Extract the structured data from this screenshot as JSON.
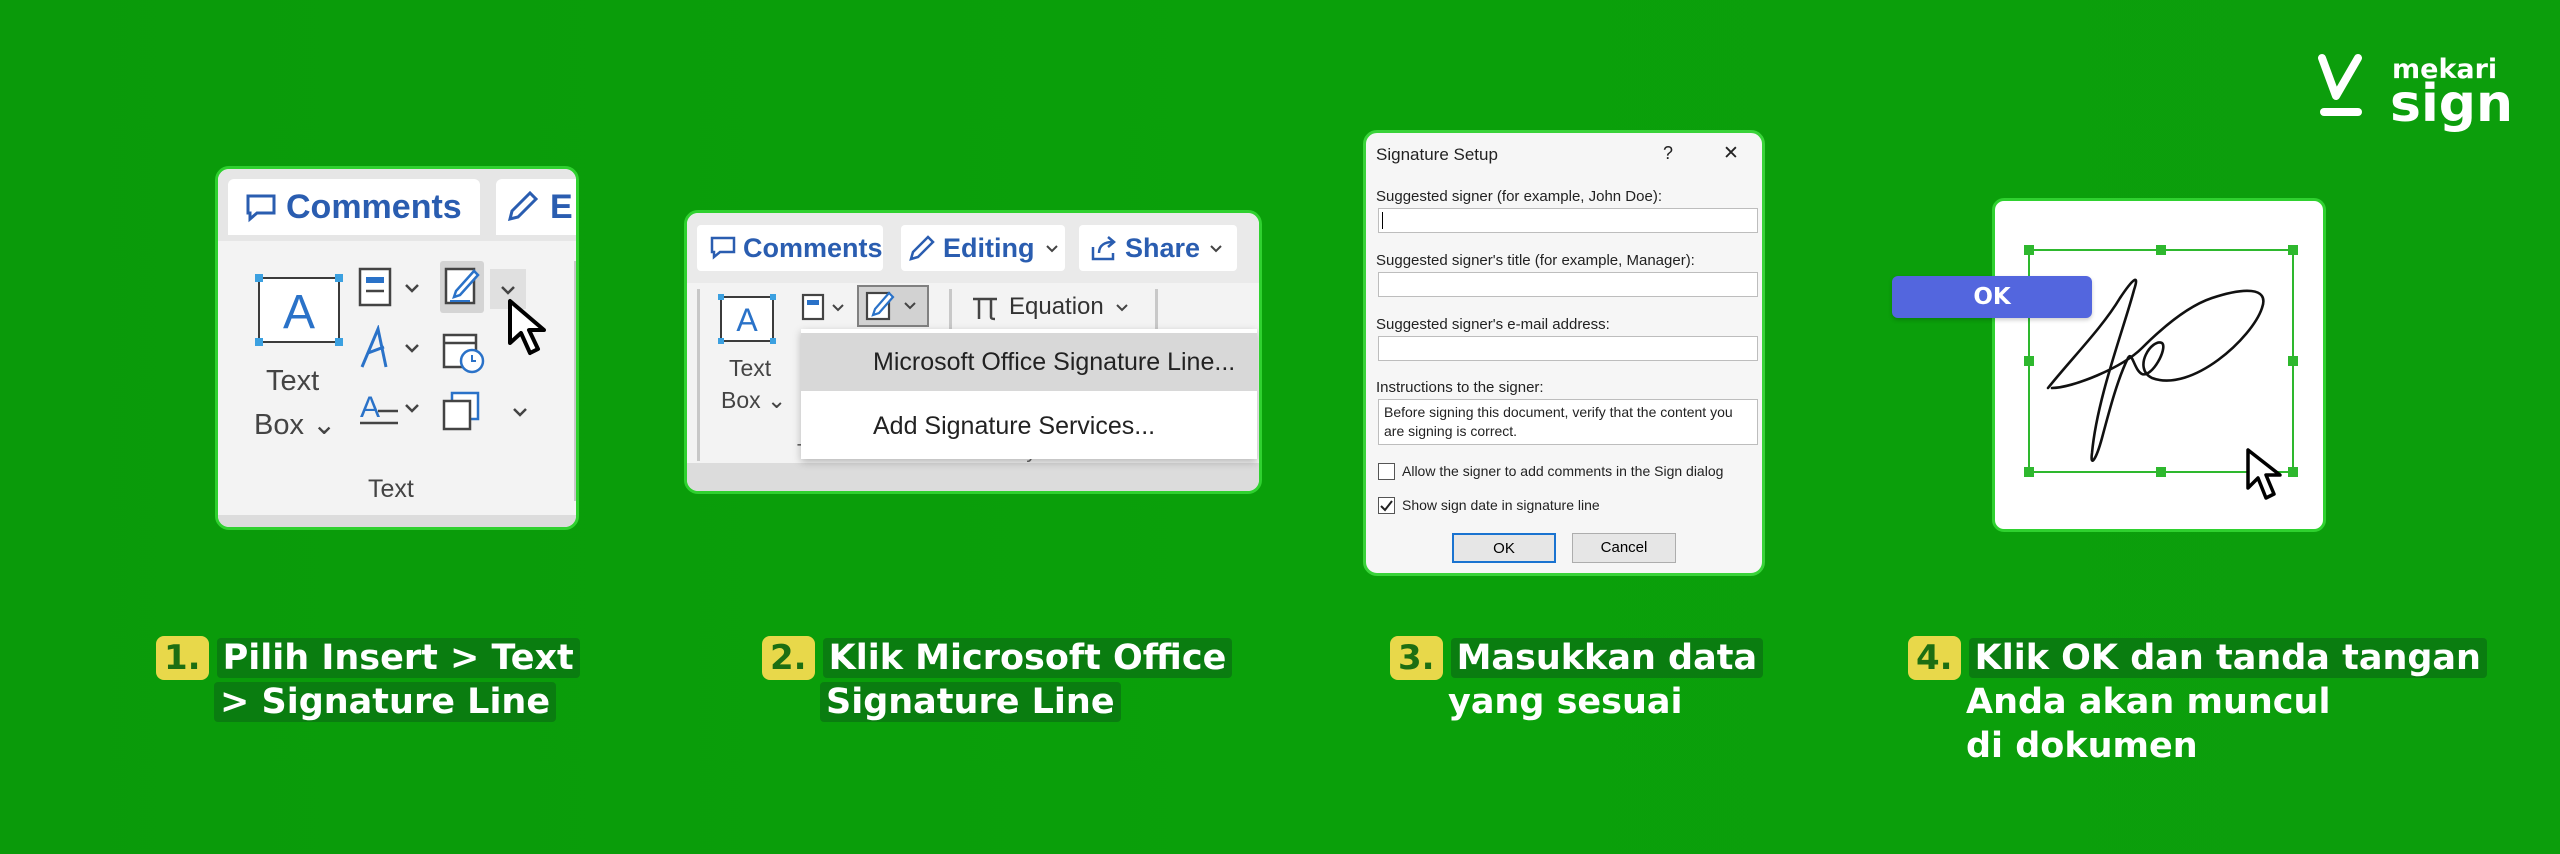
{
  "brand": {
    "word1": "mekari",
    "word2": "sign"
  },
  "step1": {
    "num": "1.",
    "caption_line1": "Pilih Insert > Text",
    "caption_line2": "> Signature Line",
    "tab_comments": "Comments",
    "tab_partial": "E",
    "text_box_l1": "Text",
    "text_box_l2": "Box ⌄",
    "group_label": "Text"
  },
  "step2": {
    "num": "2.",
    "caption_line1": "Klik Microsoft Office",
    "caption_line2": "Signature Line",
    "comments": "Comments",
    "editing": "Editing",
    "share": "Share",
    "equation": "Equation",
    "text_box_l1": "Text",
    "text_box_l2": "Box ⌄",
    "menu_item_1": "Microsoft Office Signature Line...",
    "menu_item_2": "Add Signature Services...",
    "group_text": "Text",
    "group_symbols": "Symbols"
  },
  "step3": {
    "num": "3.",
    "caption_line1": "Masukkan data",
    "caption_line2": "yang sesuai",
    "dialog_title": "Signature Setup",
    "help": "?",
    "close": "✕",
    "label_signer": "Suggested signer (for example, John Doe):",
    "label_title": "Suggested signer's title (for example, Manager):",
    "label_email": "Suggested signer's e-mail address:",
    "label_instructions": "Instructions to the signer:",
    "instructions_text": "Before signing this document, verify that the content you are signing is correct.",
    "allow_comments": "Allow the signer to add comments in the Sign dialog",
    "show_date": "Show sign date in signature line",
    "ok": "OK",
    "cancel": "Cancel",
    "allow_comments_checked": false,
    "show_date_checked": true
  },
  "step4": {
    "num": "4.",
    "caption_line1": "Klik OK dan tanda tangan",
    "caption_line2": "Anda akan muncul",
    "caption_line3": "di dokumen",
    "ok_button": "OK"
  },
  "colors": {
    "background": "#0a9a0a",
    "accent_green": "#2fd12f",
    "ok_blue": "#5366de",
    "number_badge": "#e8d84a",
    "word_blue": "#2a5db0"
  }
}
